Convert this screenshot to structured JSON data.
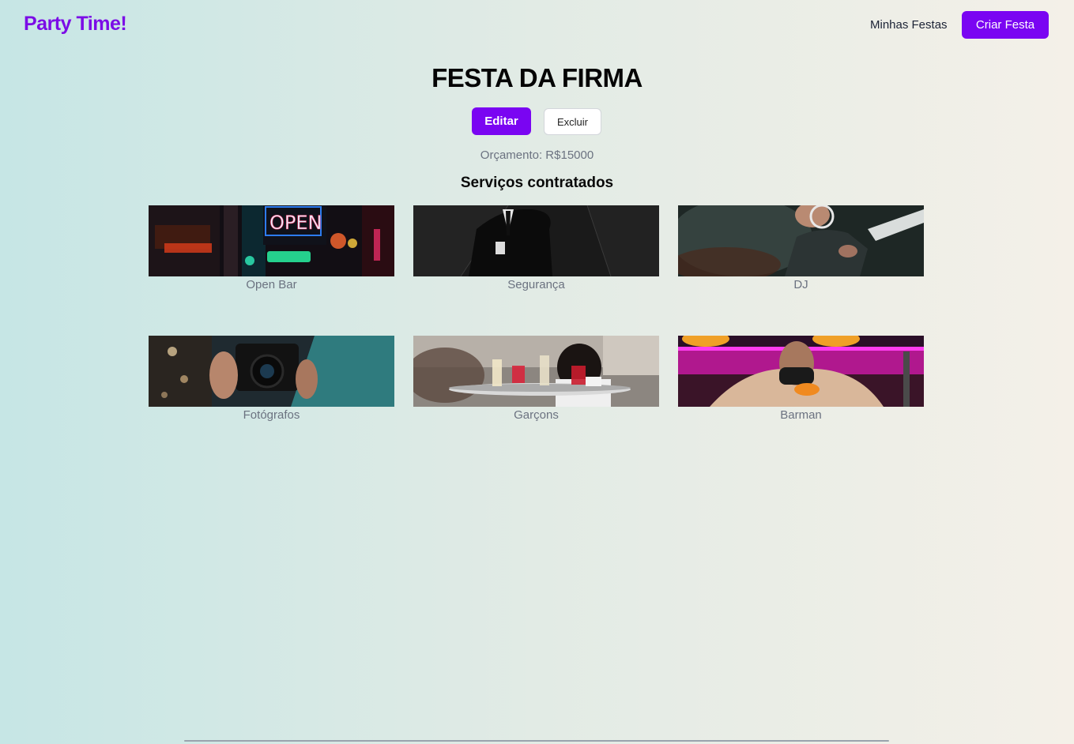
{
  "nav": {
    "logo": "Party Time!",
    "link_my_parties": "Minhas Festas",
    "cta_create": "Criar Festa"
  },
  "party": {
    "title": "FESTA DA FIRMA",
    "edit_label": "Editar",
    "delete_label": "Excluir",
    "budget": "Orçamento: R$15000",
    "services_heading": "Serviços contratados"
  },
  "services": [
    {
      "name": "Open Bar",
      "image": "neon-open-sign-photo"
    },
    {
      "name": "Segurança",
      "image": "security-guard-photo"
    },
    {
      "name": "DJ",
      "image": "dj-photo"
    },
    {
      "name": "Fotógrafos",
      "image": "photographer-photo"
    },
    {
      "name": "Garçons",
      "image": "waiter-tray-photo"
    },
    {
      "name": "Barman",
      "image": "bartender-photo"
    }
  ],
  "colors": {
    "accent": "#7a05f2",
    "logo": "#7b0ce6",
    "muted_text": "#6b7280"
  }
}
